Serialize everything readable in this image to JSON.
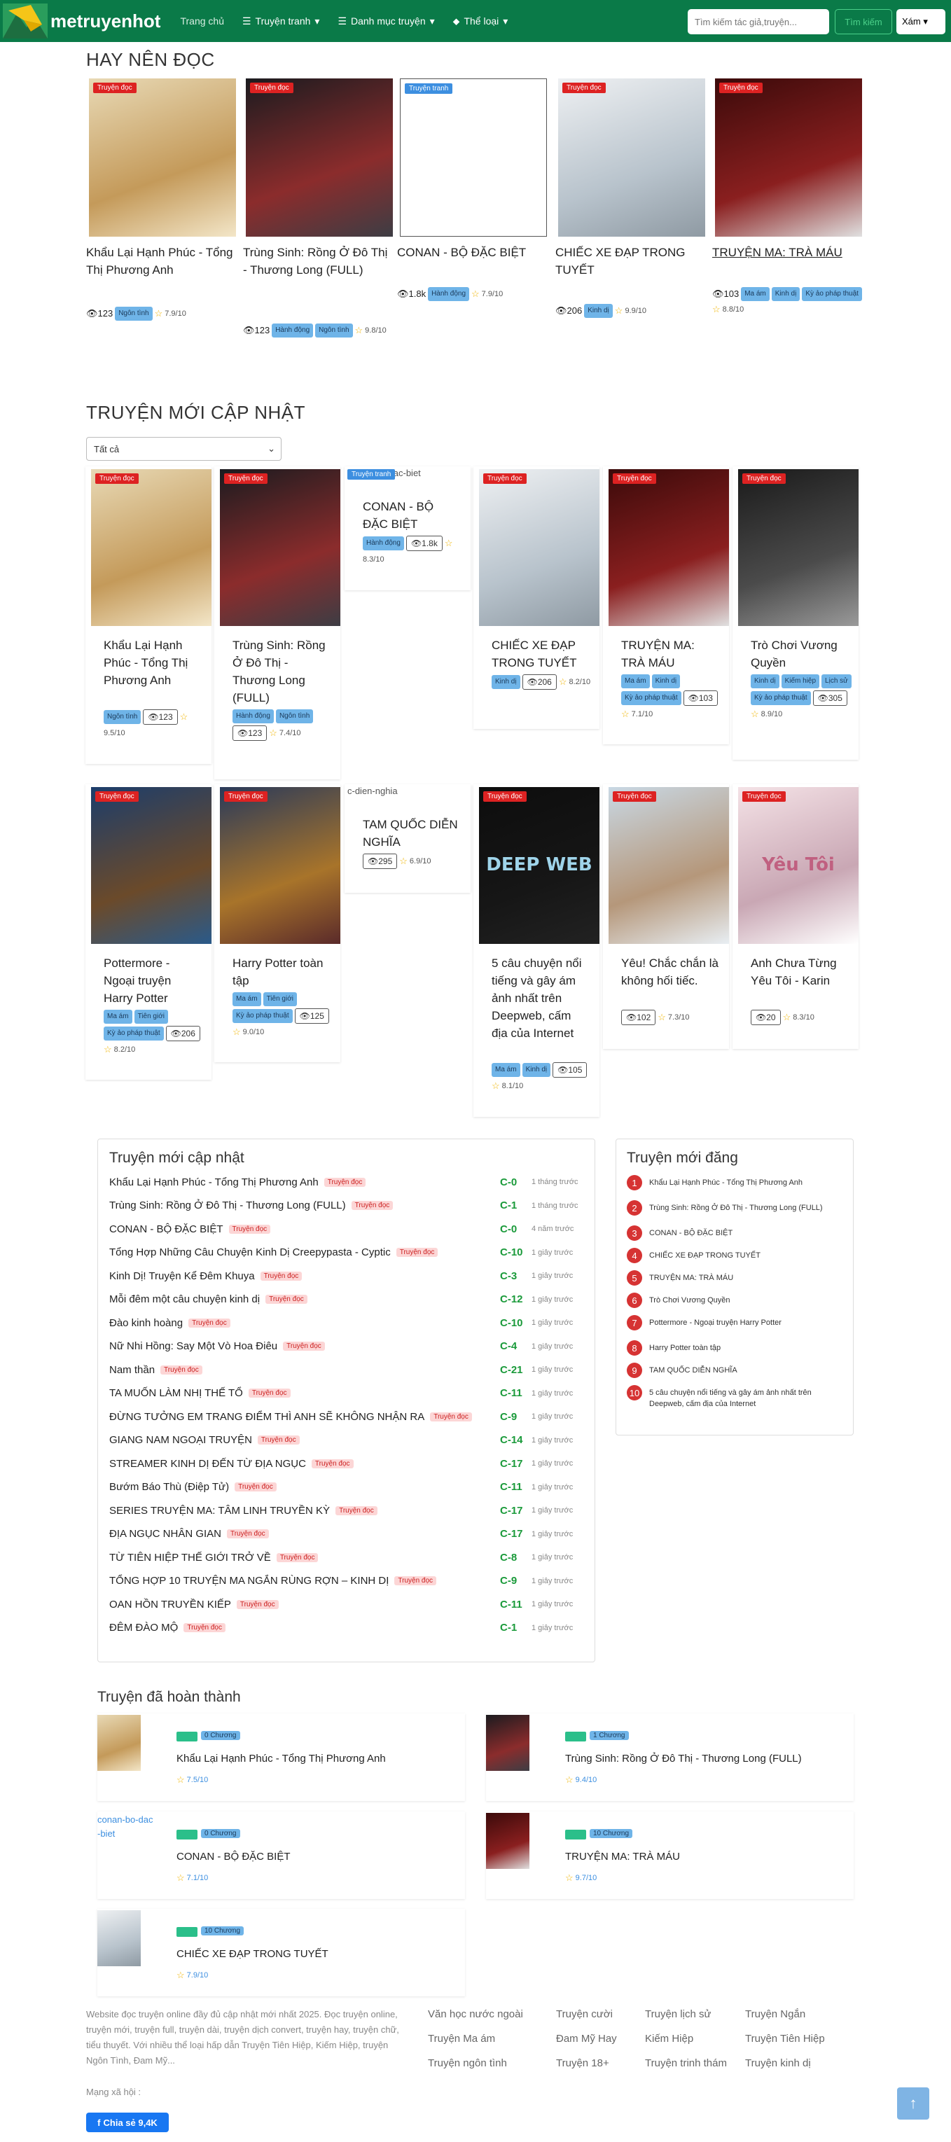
{
  "nav": {
    "logo": "metruyenhot",
    "home": "Trang chủ",
    "comics": "Truyện tranh",
    "categories": "Danh mục truyện",
    "genres": "Thể loại",
    "search_placeholder": "Tìm kiếm tác giả,truyện...",
    "search_btn": "Tìm kiếm",
    "theme": "Xám"
  },
  "recommend": {
    "title": "HAY NÊN ĐỌC",
    "items": [
      {
        "badge": "Truyện đọc",
        "title": "Khẩu Lại Hạnh Phúc - Tổng Thị Phương Anh",
        "views": "123",
        "tags": [
          "Ngôn tình"
        ],
        "rating": "7.9/10"
      },
      {
        "badge": "Truyện đọc",
        "title": "Trùng Sinh: Rồng Ở Đô Thị - Thương Long (FULL)",
        "views": "123",
        "tags": [
          "Hành động",
          "Ngôn tình"
        ],
        "rating": "9.8/10"
      },
      {
        "badge": "Truyện tranh",
        "title": "CONAN - BỘ ĐẶC BIỆT",
        "views": "1.8k",
        "tags": [
          "Hành động"
        ],
        "rating": "7.9/10"
      },
      {
        "badge": "Truyện đọc",
        "title": "CHIẾC XE ĐẠP TRONG TUYẾT",
        "views": "206",
        "tags": [
          "Kinh dị"
        ],
        "rating": "9.9/10"
      },
      {
        "badge": "Truyện đọc",
        "title": "TRUYỆN MA: TRÀ MÁU",
        "views": "103",
        "tags": [
          "Ma ám",
          "Kinh dị",
          "Kỳ ảo pháp thuật"
        ],
        "rating": "8.8/10"
      }
    ]
  },
  "latest": {
    "title": "TRUYỆN MỚI CẬP NHẬT",
    "filter": "Tất cả",
    "row1": [
      {
        "badge": "Truyện đọc",
        "title": "Khẩu Lại Hạnh Phúc - Tổng Thị Phương Anh",
        "tags": [
          "Ngôn tình"
        ],
        "views": "123",
        "rating": "9.5/10"
      },
      {
        "badge": "Truyện đọc",
        "title": "Trùng Sinh: Rồng Ở Đô Thị - Thương Long (FULL)",
        "tags": [
          "Hành động",
          "Ngôn tình"
        ],
        "views": "123",
        "rating": "7.4/10"
      },
      {
        "badge": "Truyện tranh",
        "alt": "conan-bo-dac-biet",
        "title": "CONAN - BỘ ĐẶC BIỆT",
        "tags": [
          "Hành động"
        ],
        "views": "1.8k",
        "rating": "8.3/10"
      },
      {
        "badge": "Truyện đọc",
        "title": "CHIẾC XE ĐẠP TRONG TUYẾT",
        "tags": [
          "Kinh dị"
        ],
        "views": "206",
        "rating": "8.2/10"
      },
      {
        "badge": "Truyện đọc",
        "title": "TRUYỆN MA: TRÀ MÁU",
        "tags": [
          "Ma ám",
          "Kinh dị",
          "Kỳ ảo pháp thuật"
        ],
        "views": "103",
        "rating": "7.1/10"
      },
      {
        "badge": "Truyện đọc",
        "title": "Trò Chơi Vương Quyền",
        "tags": [
          "Kinh dị",
          "Kiếm hiệp",
          "Lịch sử",
          "Kỳ ảo pháp thuật"
        ],
        "views": "305",
        "rating": "8.9/10"
      }
    ],
    "row2": [
      {
        "badge": "Truyện đọc",
        "title": "Pottermore - Ngoại truyện Harry Potter",
        "tags": [
          "Ma ám",
          "Tiên giới",
          "Kỳ ảo pháp thuật"
        ],
        "views": "206",
        "rating": "8.2/10"
      },
      {
        "badge": "Truyện đọc",
        "title": "Harry Potter toàn tập",
        "tags": [
          "Ma ám",
          "Tiên giới",
          "Kỳ ảo pháp thuật"
        ],
        "views": "125",
        "rating": "9.0/10"
      },
      {
        "badge": "",
        "alt": "c-dien-nghia",
        "title": "TAM QUỐC DIỄN NGHĨA",
        "tags": [],
        "views": "295",
        "rating": "6.9/10"
      },
      {
        "badge": "Truyện đọc",
        "cover_text": "DEEP WEB",
        "title": "5 câu chuyện nổi tiếng và gây ám ảnh nhất trên Deepweb, cấm địa của Internet",
        "tags": [
          "Ma ám",
          "Kinh dị"
        ],
        "views": "105",
        "rating": "8.1/10"
      },
      {
        "badge": "Truyện đọc",
        "title": "Yêu! Chắc chắn là không hối tiếc.",
        "tags": [],
        "views": "102",
        "rating": "7.3/10"
      },
      {
        "badge": "Truyện đọc",
        "cover_text": "Yêu Tôi",
        "title": "Anh Chưa Từng Yêu Tôi - Karin",
        "tags": [],
        "views": "20",
        "rating": "8.3/10"
      }
    ]
  },
  "updates": {
    "title": "Truyện mới cập nhật",
    "rows": [
      {
        "t": "Khẩu Lại Hạnh Phúc - Tổng Thị Phương Anh",
        "c": "C-0",
        "time": "1 tháng trước"
      },
      {
        "t": "Trùng Sinh: Rồng Ở Đô Thị - Thương Long (FULL)",
        "c": "C-1",
        "time": "1 tháng trước"
      },
      {
        "t": "CONAN - BỘ ĐẶC BIỆT",
        "c": "C-0",
        "time": "4 năm trước"
      },
      {
        "t": "Tổng Hợp Những Câu Chuyện Kinh Dị Creepypasta - Cyptic",
        "c": "C-10",
        "time": "1 giây trước"
      },
      {
        "t": "Kinh Dị! Truyện Kể Đêm Khuya",
        "c": "C-3",
        "time": "1 giây trước"
      },
      {
        "t": "Mỗi đêm một câu chuyện kinh dị",
        "c": "C-12",
        "time": "1 giây trước"
      },
      {
        "t": "Đào kinh hoàng",
        "c": "C-10",
        "time": "1 giây trước"
      },
      {
        "t": "Nữ Nhi Hồng: Say Một Vò Hoa Điêu",
        "c": "C-4",
        "time": "1 giây trước"
      },
      {
        "t": "Nam thần",
        "c": "C-21",
        "time": "1 giây trước"
      },
      {
        "t": "TA MUỐN LÀM NHỊ THẾ TỔ",
        "c": "C-11",
        "time": "1 giây trước"
      },
      {
        "t": "ĐỪNG TƯỞNG EM TRANG ĐIỂM THÌ ANH SẼ KHÔNG NHẬN RA",
        "c": "C-9",
        "time": "1 giây trước"
      },
      {
        "t": "GIANG NAM NGOẠI TRUYỆN",
        "c": "C-14",
        "time": "1 giây trước"
      },
      {
        "t": "STREAMER KINH DỊ ĐẾN TỪ ĐỊA NGỤC",
        "c": "C-17",
        "time": "1 giây trước"
      },
      {
        "t": "Bướm Báo Thù (Điệp Tử)",
        "c": "C-11",
        "time": "1 giây trước"
      },
      {
        "t": "SERIES TRUYỆN MA: TÂM LINH TRUYỀN KỲ",
        "c": "C-17",
        "time": "1 giây trước"
      },
      {
        "t": "ĐỊA NGỤC NHÂN GIAN",
        "c": "C-17",
        "time": "1 giây trước"
      },
      {
        "t": "TỪ TIÊN HIỆP THẾ GIỚI TRỞ VỀ",
        "c": "C-8",
        "time": "1 giây trước"
      },
      {
        "t": "TỔNG HỢP 10 TRUYỆN MA NGẮN RÙNG RỢN – KINH DỊ",
        "c": "C-9",
        "time": "1 giây trước"
      },
      {
        "t": "OAN HỒN TRUYỀN KIẾP",
        "c": "C-11",
        "time": "1 giây trước"
      },
      {
        "t": "ĐÊM ĐÀO MỘ",
        "c": "C-1",
        "time": "1 giây trước"
      }
    ],
    "pill": "Truyện đọc"
  },
  "newest": {
    "title": "Truyện mới đăng",
    "rows": [
      "Khẩu Lại Hạnh Phúc - Tổng Thị Phương Anh",
      "Trùng Sinh: Rồng Ở Đô Thị - Thương Long (FULL)",
      "CONAN - BỘ ĐẶC BIỆT",
      "CHIẾC XE ĐẠP TRONG TUYẾT",
      "TRUYỆN MA: TRÀ MÁU",
      "Trò Chơi Vương Quyền",
      "Pottermore - Ngoại truyện Harry Potter",
      "Harry Potter toàn tập",
      "TAM QUỐC DIỄN NGHĨA",
      "5 câu chuyện nổi tiếng và gây ám ảnh nhất trên Deepweb, cấm địa của Internet"
    ]
  },
  "completed": {
    "title": "Truyện đã hoàn thành",
    "items": [
      {
        "title": "Khẩu Lại Hạnh Phúc - Tổng Thị Phương Anh",
        "chapters": "0 Chương",
        "rating": "7.5/10"
      },
      {
        "title": "Trùng Sinh: Rồng Ở Đô Thị - Thương Long (FULL)",
        "chapters": "1 Chương",
        "rating": "9.4/10"
      },
      {
        "title": "CONAN - BỘ ĐẶC BIỆT",
        "chapters": "0 Chương",
        "rating": "7.1/10",
        "alt": "conan-bo-dac-biet"
      },
      {
        "title": "TRUYỆN MA: TRÀ MÁU",
        "chapters": "10 Chương",
        "rating": "9.7/10"
      },
      {
        "title": "CHIẾC XE ĐẠP TRONG TUYẾT",
        "chapters": "10 Chương",
        "rating": "7.9/10"
      }
    ]
  },
  "footer": {
    "text": "Website đọc truyện online đầy đủ cập nhật mới nhất 2025. Đọc truyện online, truyện mới, truyện full, truyện dài, truyện dịch convert, truyện hay, truyện chữ, tiểu thuyết. Với nhiều thể loại hấp dẫn Truyện Tiên Hiệp, Kiếm Hiệp, truyện Ngôn Tình, Đam Mỹ...",
    "social": "Mạng xã hội :",
    "share": "Chia sẻ 9,4K",
    "links": [
      "Văn học nước ngoài",
      "Truyện cười",
      "Truyện lịch sử",
      "Truyện Ngắn",
      "Truyện Ma ám",
      "Đam Mỹ Hay",
      "Kiếm Hiệp",
      "Truyện Tiên Hiệp",
      "Truyện ngôn tình",
      "Truyện 18+",
      "Truyện trinh thám",
      "Truyện kinh dị"
    ]
  },
  "totop": "↑",
  "colors": {
    "nav": "#0a7a48",
    "badge_red": "#d22222",
    "tag_blue": "#6fb4e8",
    "chapter_green": "#1a9a3a",
    "number_red": "#d63333"
  }
}
